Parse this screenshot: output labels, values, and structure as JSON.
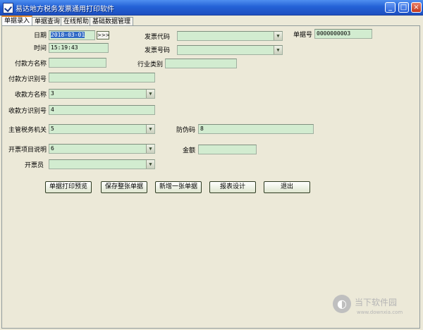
{
  "window": {
    "title": "易达地方税务发票通用打印软件",
    "minimize_glyph": "_",
    "maximize_glyph": "□",
    "close_glyph": "×"
  },
  "tabs": [
    {
      "label": "单据录入"
    },
    {
      "label": "单据查询"
    },
    {
      "label": "在线帮助"
    },
    {
      "label": "基础数据管理"
    }
  ],
  "form": {
    "date_label": "日期",
    "date_value": "2018-03-01",
    "date_nav_label": ">>>",
    "time_label": "时间",
    "time_value": "15:19:43",
    "invoice_code_label": "发票代码",
    "invoice_code_value": "",
    "invoice_number_label": "发票号码",
    "invoice_number_value": "",
    "receipt_no_label": "单据号",
    "receipt_no_value": "0000000003",
    "payer_name_label": "付款方名称",
    "payer_name_value": "",
    "industry_label": "行业类别",
    "industry_value": "",
    "payer_id_label": "付款方识别号",
    "payer_id_value": "",
    "payee_name_label": "收款方名称",
    "payee_name_value": "3",
    "payee_id_label": "收款方识别号",
    "payee_id_value": "4",
    "tax_authority_label": "主管税务机关",
    "tax_authority_value": "5",
    "anti_fake_label": "防伪码",
    "anti_fake_value": "8",
    "item_desc_label": "开票项目说明",
    "item_desc_value": "6",
    "amount_label": "金额",
    "amount_value": "",
    "issuer_label": "开票员",
    "issuer_value": ""
  },
  "buttons": {
    "print_preview": "单据打印预览",
    "save": "保存整张单据",
    "add_new": "新增一张单据",
    "report_design": "报表设计",
    "exit": "退出"
  },
  "watermark": {
    "name": "当下软件园",
    "url": "www.downxia.com"
  },
  "colors": {
    "titlebar": "#2462d6",
    "field_bg": "#d2ecd0",
    "window_bg": "#ece9d8",
    "selection": "#316ac5"
  }
}
